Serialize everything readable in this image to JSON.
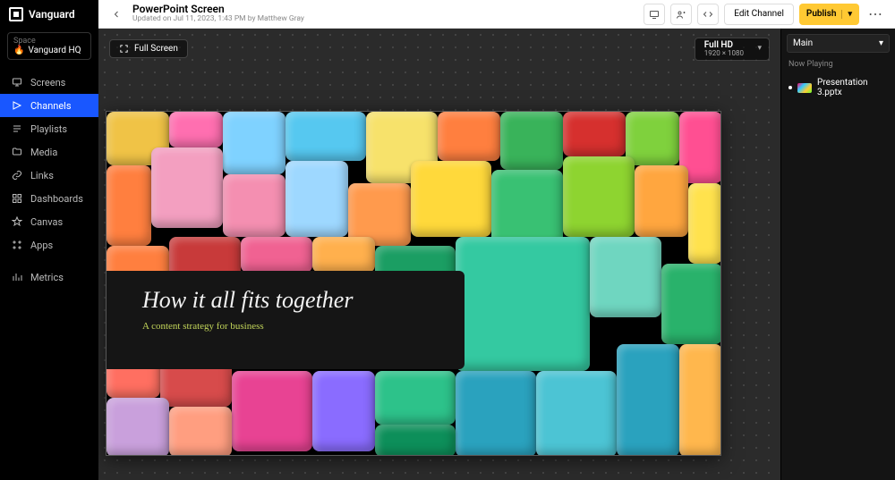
{
  "brand": "Vanguard",
  "space": {
    "label": "Space",
    "name": "Vanguard HQ",
    "emoji": "🔥"
  },
  "nav": {
    "screens": "Screens",
    "channels": "Channels",
    "playlists": "Playlists",
    "media": "Media",
    "links": "Links",
    "dashboards": "Dashboards",
    "canvas": "Canvas",
    "apps": "Apps",
    "metrics": "Metrics"
  },
  "header": {
    "title": "PowerPoint Screen",
    "updated_prefix": "Updated on ",
    "updated_date": "Jul 11, 2023, 1:43 PM",
    "by": " by ",
    "author": "Matthew Gray",
    "edit_channel": "Edit Channel",
    "publish": "Publish"
  },
  "canvas": {
    "full_screen": "Full Screen",
    "resolution_name": "Full HD",
    "resolution_value": "1920 × 1080"
  },
  "slide": {
    "title": "How it all fits together",
    "subtitle": "A content strategy for business"
  },
  "right": {
    "zone": "Main",
    "now_playing": "Now Playing",
    "item": "Presentation 3.pptx"
  },
  "colors": {
    "accent": "#1957ff",
    "publish": "#ffc933"
  }
}
